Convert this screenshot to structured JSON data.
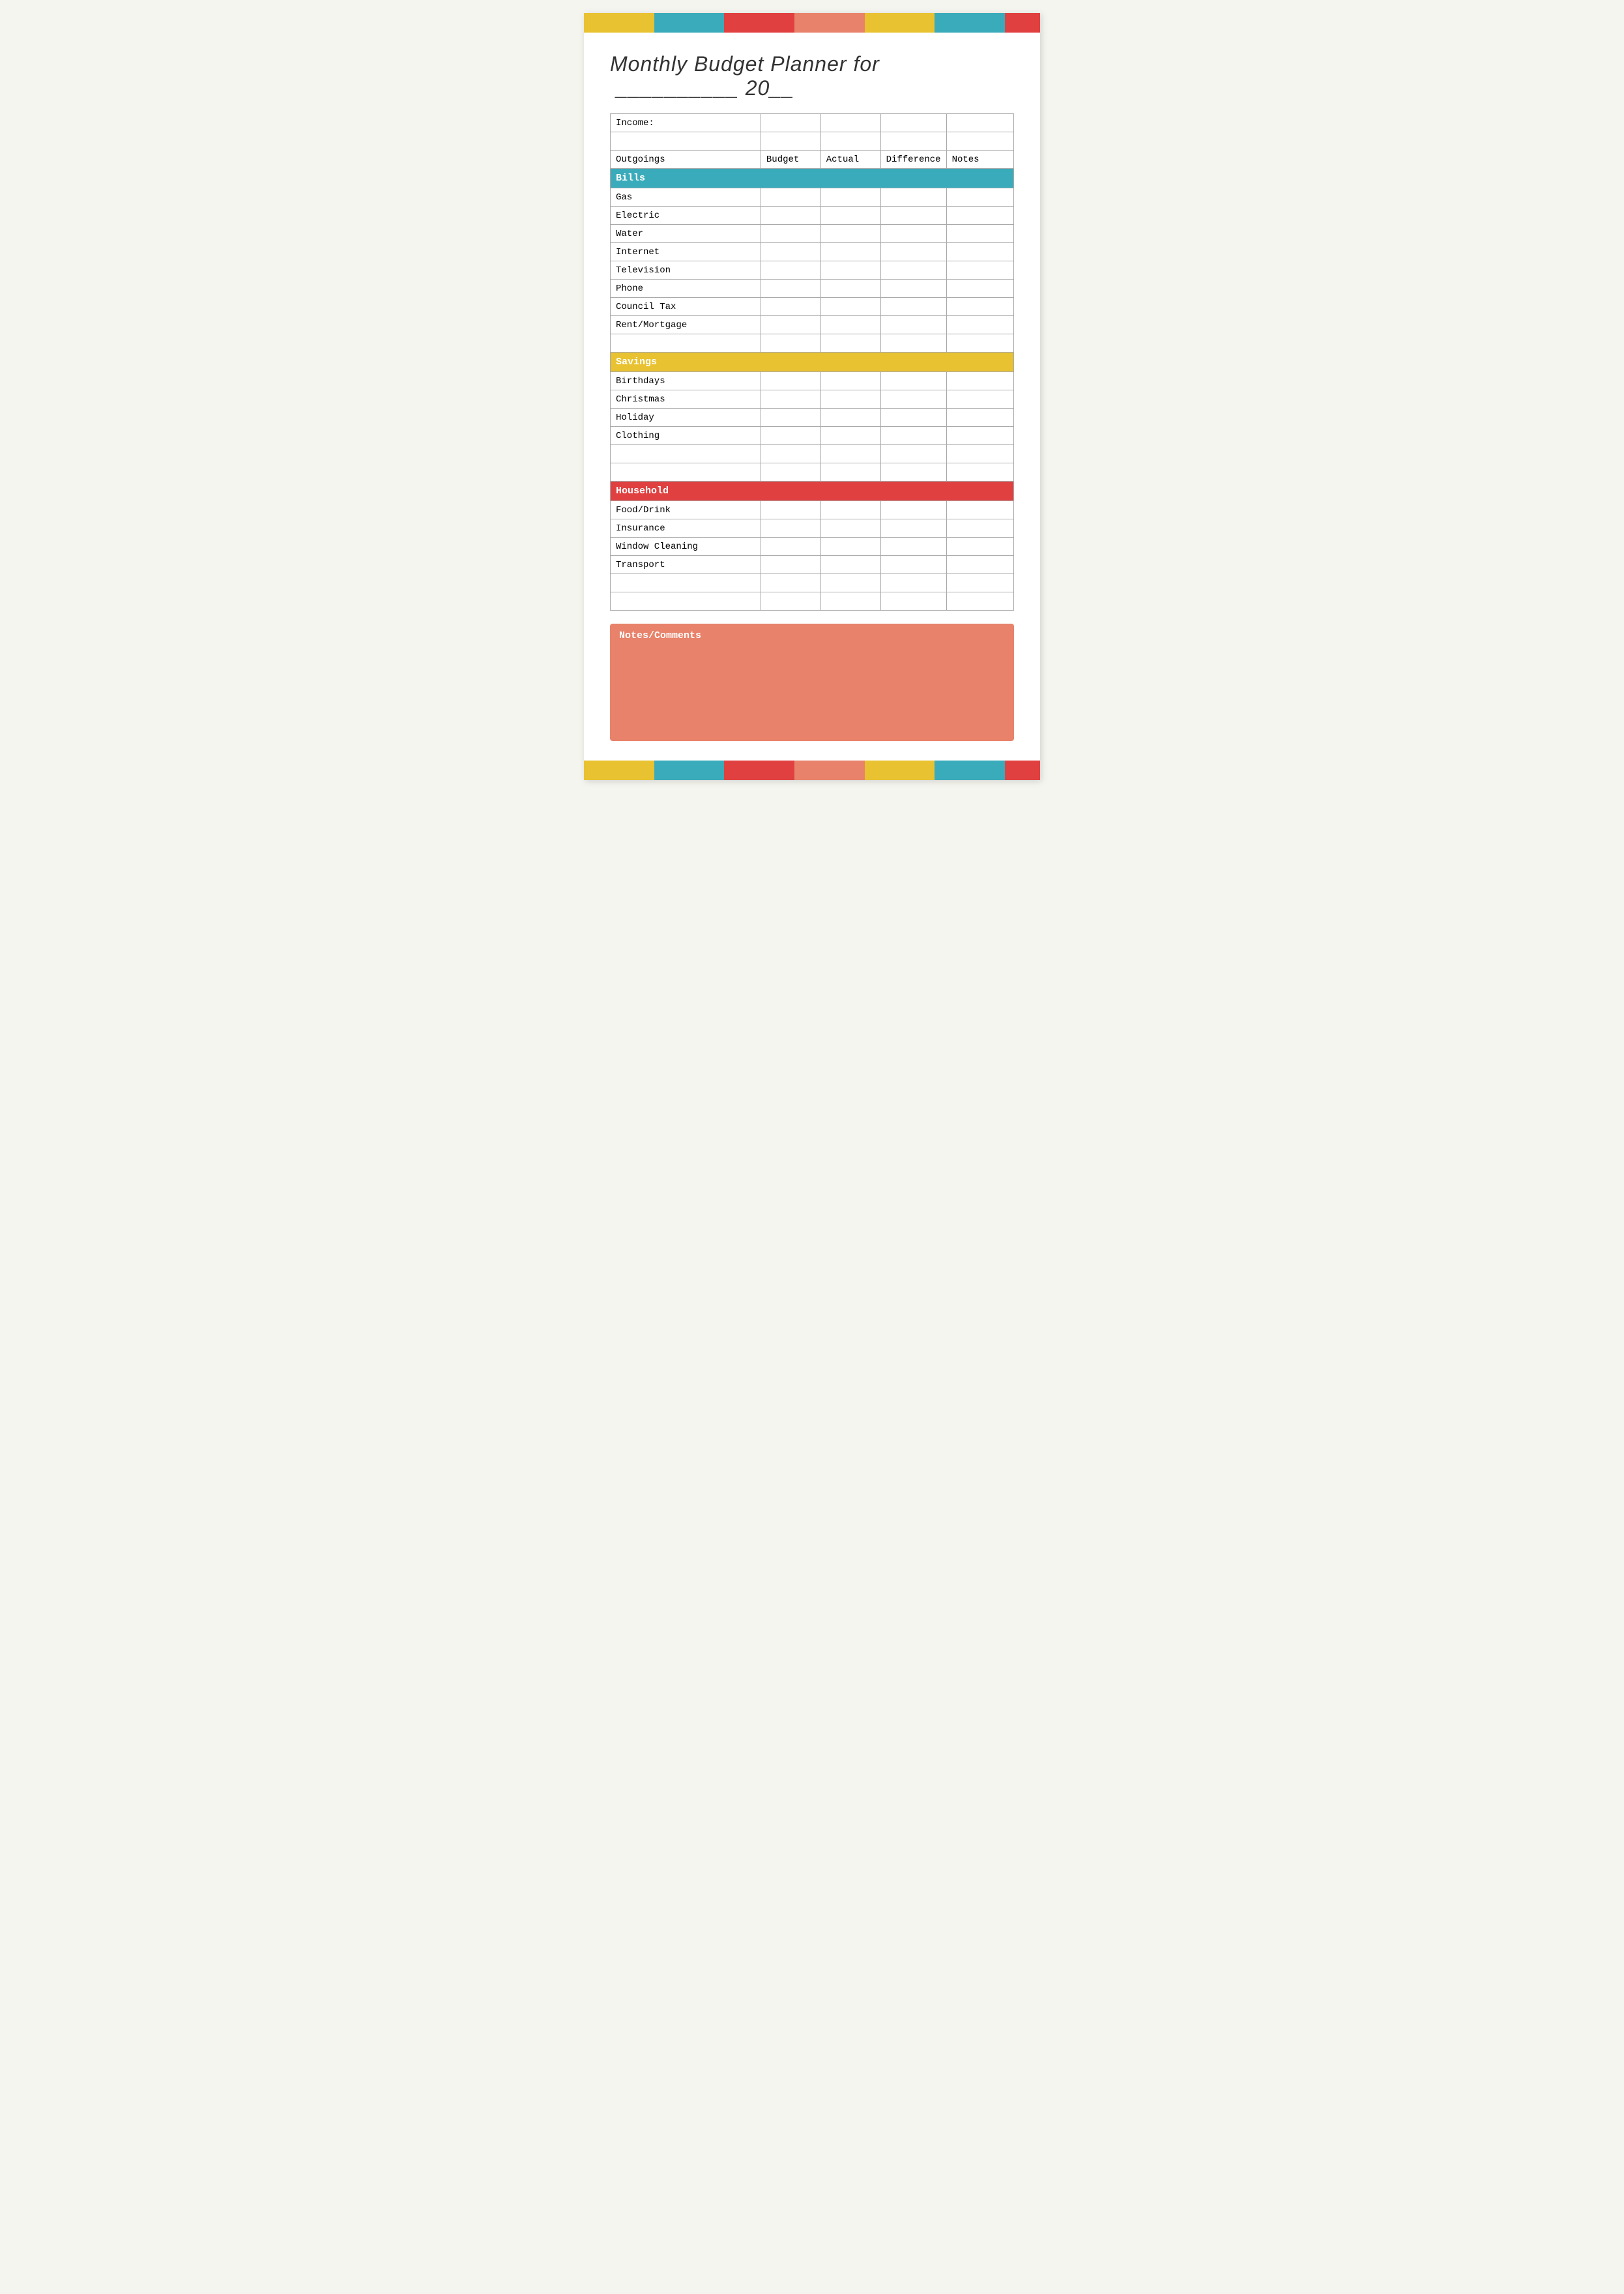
{
  "title": "Monthly Budget Planner for",
  "title_line": "__________ 20__",
  "top_banner": [
    {
      "color": "#e8c230",
      "flex": 2
    },
    {
      "color": "#3aabba",
      "flex": 2
    },
    {
      "color": "#e04040",
      "flex": 2
    },
    {
      "color": "#e8826a",
      "flex": 2
    },
    {
      "color": "#e8c230",
      "flex": 2
    },
    {
      "color": "#3aabba",
      "flex": 2
    },
    {
      "color": "#e04040",
      "flex": 1
    }
  ],
  "bottom_banner": [
    {
      "color": "#e8c230",
      "flex": 2
    },
    {
      "color": "#3aabba",
      "flex": 2
    },
    {
      "color": "#e04040",
      "flex": 2
    },
    {
      "color": "#e8826a",
      "flex": 2
    },
    {
      "color": "#e8c230",
      "flex": 2
    },
    {
      "color": "#3aabba",
      "flex": 2
    },
    {
      "color": "#e04040",
      "flex": 1
    }
  ],
  "income_label": "Income:",
  "columns": {
    "category": "",
    "budget": "Budget",
    "actual": "Actual",
    "difference": "Difference",
    "notes": "Notes"
  },
  "outgoings_label": "Outgoings",
  "sections": {
    "bills": {
      "label": "Bills",
      "items": [
        "Gas",
        "Electric",
        "Water",
        "Internet",
        "Television",
        "Phone",
        "Council Tax",
        "Rent/Mortgage"
      ]
    },
    "savings": {
      "label": "Savings",
      "items": [
        "Birthdays",
        "Christmas",
        "Holiday",
        "Clothing"
      ]
    },
    "household": {
      "label": "Household",
      "items": [
        "Food/Drink",
        "Insurance",
        "Window Cleaning",
        "Transport"
      ]
    }
  },
  "notes_section": {
    "label": "Notes/Comments"
  }
}
